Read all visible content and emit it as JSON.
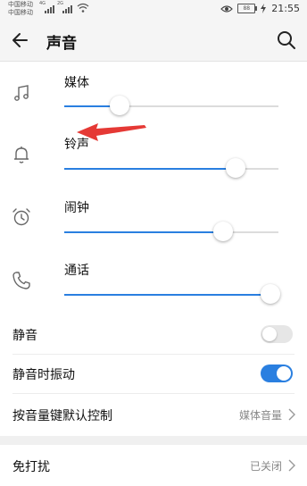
{
  "status_bar": {
    "carrier_1": "中国移动",
    "carrier_2": "中国移动",
    "net_1": "4G",
    "net_2": "2G",
    "battery": "88",
    "time": "21:55"
  },
  "header": {
    "title": "声音"
  },
  "volumes": [
    {
      "label": "媒体",
      "level": 0.26
    },
    {
      "label": "铃声",
      "level": 0.8
    },
    {
      "label": "闹钟",
      "level": 0.74
    },
    {
      "label": "通话",
      "level": 1.0
    }
  ],
  "settings": {
    "mute": {
      "label": "静音",
      "enabled": false
    },
    "vibrate_on_mute": {
      "label": "静音时振动",
      "enabled": true
    },
    "volume_key": {
      "label": "按音量键默认控制",
      "value": "媒体音量"
    }
  },
  "dnd": {
    "label": "免打扰",
    "value": "已关闭"
  },
  "colors": {
    "accent": "#2a7fe0",
    "annotation_arrow": "#e53935"
  }
}
